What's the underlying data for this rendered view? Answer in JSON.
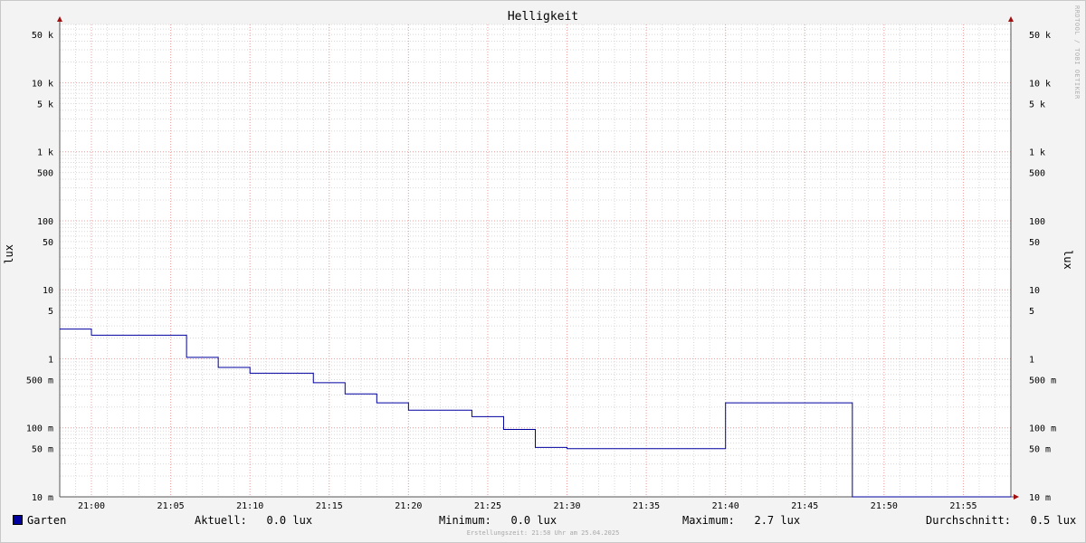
{
  "chart_data": {
    "type": "line",
    "title": "Helligkeit",
    "ylabel": "lux",
    "yscale": "log",
    "ylim": [
      10,
      70000
    ],
    "xlim": [
      "20:58",
      "21:58"
    ],
    "x_ticks": [
      "21:00",
      "21:05",
      "21:10",
      "21:15",
      "21:20",
      "21:25",
      "21:30",
      "21:35",
      "21:40",
      "21:45",
      "21:50",
      "21:55"
    ],
    "y_ticks": [
      {
        "value": 50000,
        "label": "50 k"
      },
      {
        "value": 10000,
        "label": "10 k"
      },
      {
        "value": 5000,
        "label": "5 k"
      },
      {
        "value": 1000,
        "label": "1 k"
      },
      {
        "value": 500,
        "label": "500"
      },
      {
        "value": 100,
        "label": "100"
      },
      {
        "value": 50,
        "label": "50"
      },
      {
        "value": 10,
        "label": "10"
      },
      {
        "value": 5,
        "label": "5"
      },
      {
        "value": 1,
        "label": "1"
      },
      {
        "value": 0.5,
        "label": "500 m"
      },
      {
        "value": 0.1,
        "label": "100 m"
      },
      {
        "value": 0.05,
        "label": "50 m"
      },
      {
        "value": 0.01,
        "label": "10 m"
      }
    ],
    "grid": true,
    "series": [
      {
        "name": "Garten",
        "color": "#0000a0",
        "step": true,
        "x": [
          "20:58",
          "21:00",
          "21:06",
          "21:08",
          "21:10",
          "21:14",
          "21:16",
          "21:18",
          "21:20",
          "21:24",
          "21:26",
          "21:28",
          "21:30",
          "21:40",
          "21:48",
          "21:58"
        ],
        "y": [
          2.7,
          2.2,
          1.05,
          0.75,
          0.62,
          0.45,
          0.31,
          0.23,
          0.18,
          0.145,
          0.095,
          0.052,
          0.05,
          0.23,
          0.01,
          0.01
        ]
      }
    ]
  },
  "legend": {
    "series_name": "Garten",
    "current": "Aktuell:   0.0 lux",
    "minimum": "Minimum:   0.0 lux",
    "maximum": "Maximum:   2.7 lux",
    "average": "Durchschnitt:   0.5 lux"
  },
  "watermark": "RRDTOOL / TOBI OETIKER",
  "footer": "Erstellungszeit: 21:58 Uhr am 25.04.2025"
}
